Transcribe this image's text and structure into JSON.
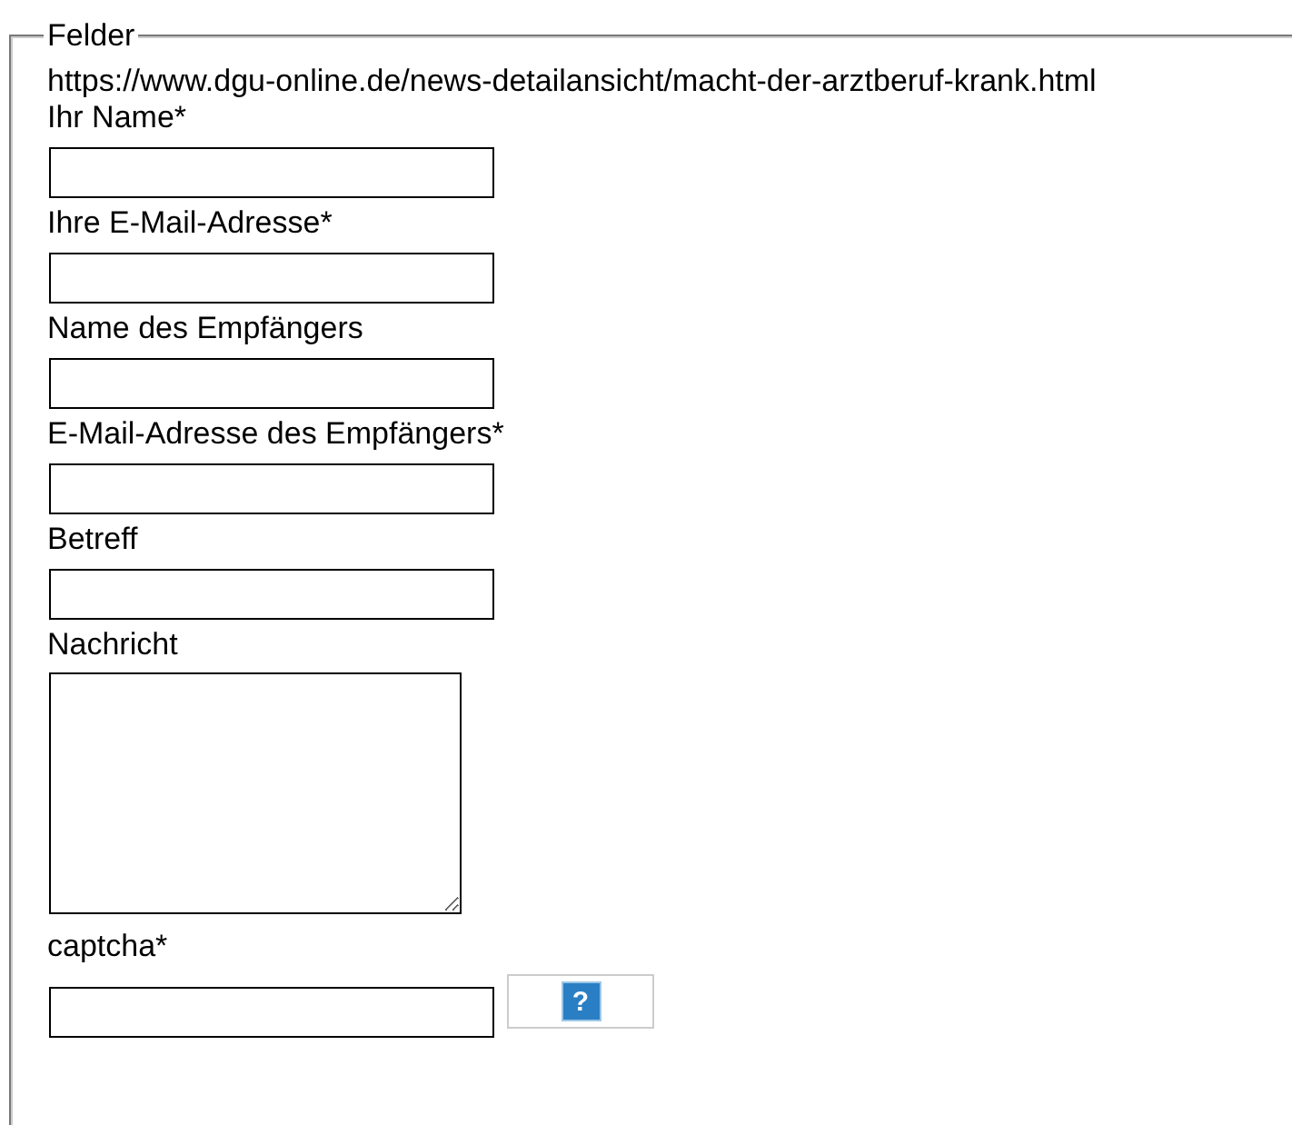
{
  "fieldset": {
    "legend": "Felder",
    "url": "https://www.dgu-online.de/news-detailansicht/macht-der-arztberuf-krank.html",
    "fields": [
      {
        "kind": "input",
        "label": "Ihr Name*"
      },
      {
        "kind": "input",
        "label": "Ihre E-Mail-Adresse*"
      },
      {
        "kind": "input",
        "label": "Name des Empfängers"
      },
      {
        "kind": "input",
        "label": "E-Mail-Adresse des Empfängers*"
      },
      {
        "kind": "input",
        "label": "Betreff"
      },
      {
        "kind": "textarea",
        "label": "Nachricht"
      },
      {
        "kind": "captcha",
        "label": "captcha*",
        "help": "?"
      }
    ]
  }
}
